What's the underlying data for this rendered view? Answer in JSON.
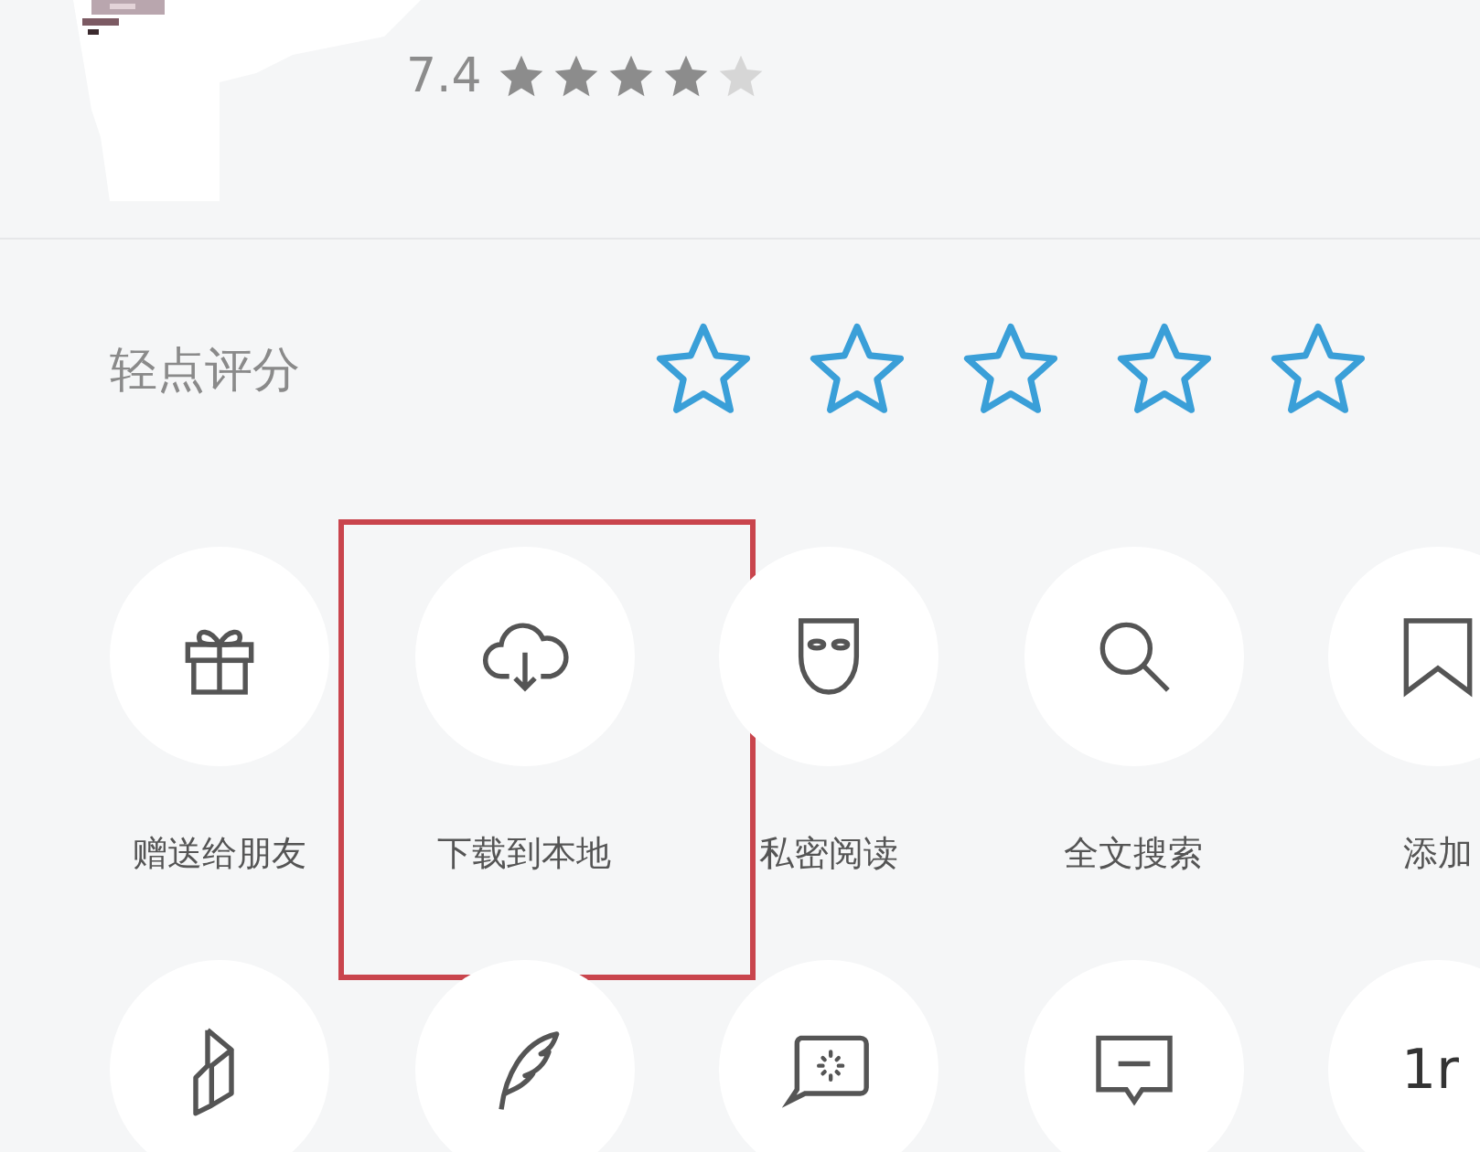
{
  "book": {
    "score": "7.4",
    "stars": 4
  },
  "rating": {
    "label": "轻点评分",
    "stars": 0
  },
  "actions": [
    {
      "label": "赠送给朋友",
      "highlighted": false
    },
    {
      "label": "下载到本地",
      "highlighted": true
    },
    {
      "label": "私密阅读",
      "highlighted": false
    },
    {
      "label": "全文搜索",
      "highlighted": false
    },
    {
      "label": "添加",
      "highlighted": false
    },
    {
      "highlighted": false
    },
    {
      "highlighted": false
    },
    {
      "highlighted": false
    },
    {
      "highlighted": false
    },
    {
      "text": "1r",
      "highlighted": false
    }
  ]
}
